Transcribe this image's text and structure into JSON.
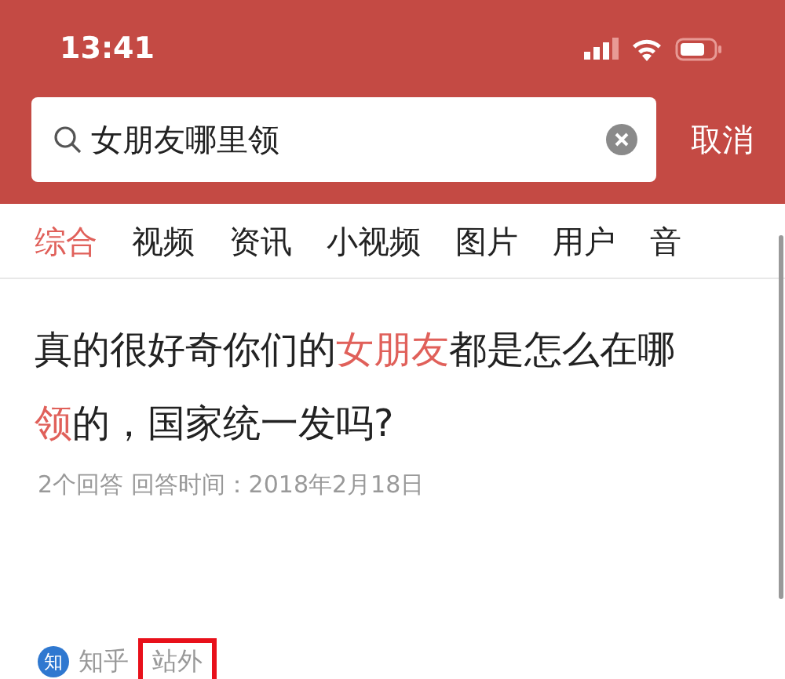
{
  "status_bar": {
    "time": "13:41"
  },
  "search": {
    "value": "女朋友哪里领",
    "cancel": "取消"
  },
  "tabs": [
    {
      "label": "综合",
      "selected": true
    },
    {
      "label": "视频",
      "selected": false
    },
    {
      "label": "资讯",
      "selected": false
    },
    {
      "label": "小视频",
      "selected": false
    },
    {
      "label": "图片",
      "selected": false
    },
    {
      "label": "用户",
      "selected": false
    },
    {
      "label": "音",
      "selected": false
    }
  ],
  "result": {
    "title": [
      {
        "text": "真的很好奇你们的",
        "highlight": false
      },
      {
        "text": "女朋友",
        "highlight": true
      },
      {
        "text": "都是怎么在哪",
        "highlight": false
      },
      {
        "text": "领",
        "highlight": true
      },
      {
        "text": "的，国家统一发吗?",
        "highlight": false
      }
    ],
    "meta": "2个回答 回答时间：2018年2月18日",
    "source_icon": "知",
    "source": "知乎",
    "tag": "站外",
    "tag_highlighted": true
  }
}
